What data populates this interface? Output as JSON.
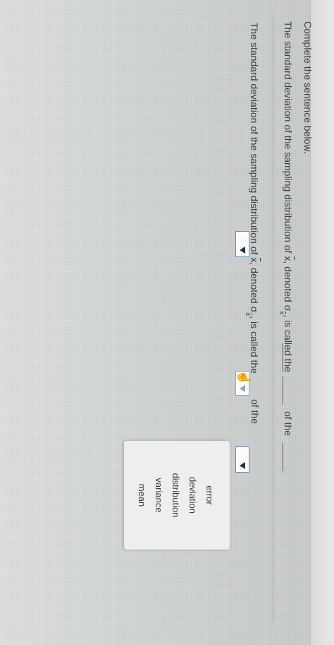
{
  "prompt": {
    "title": "Complete the sentence below."
  },
  "question1": {
    "text_before": "The standard deviation of the sampling distribution of ",
    "xbar": "x",
    "text_mid": ", denoted ",
    "sigma": "σ",
    "sigma_sub": "x",
    "text_after": ", is called the",
    "of_the": "of the"
  },
  "question2": {
    "text_before": "The standard deviation of the sampling distribution of ",
    "xbar": "x",
    "text_mid": ", denoted ",
    "sigma": "σ",
    "sigma_sub": "x",
    "text_after": ", is called the",
    "of_the": "of the"
  },
  "dropdown_options": [
    "error",
    "deviation",
    "distribution",
    "variance",
    "mean"
  ],
  "icons": {
    "dropdown_arrow": "triangle-down",
    "cursor": "hand-pointer"
  },
  "colors": {
    "dropdown_border": "#6f86b3",
    "arrow": "#1f2d4a",
    "text": "#3a3d40"
  }
}
